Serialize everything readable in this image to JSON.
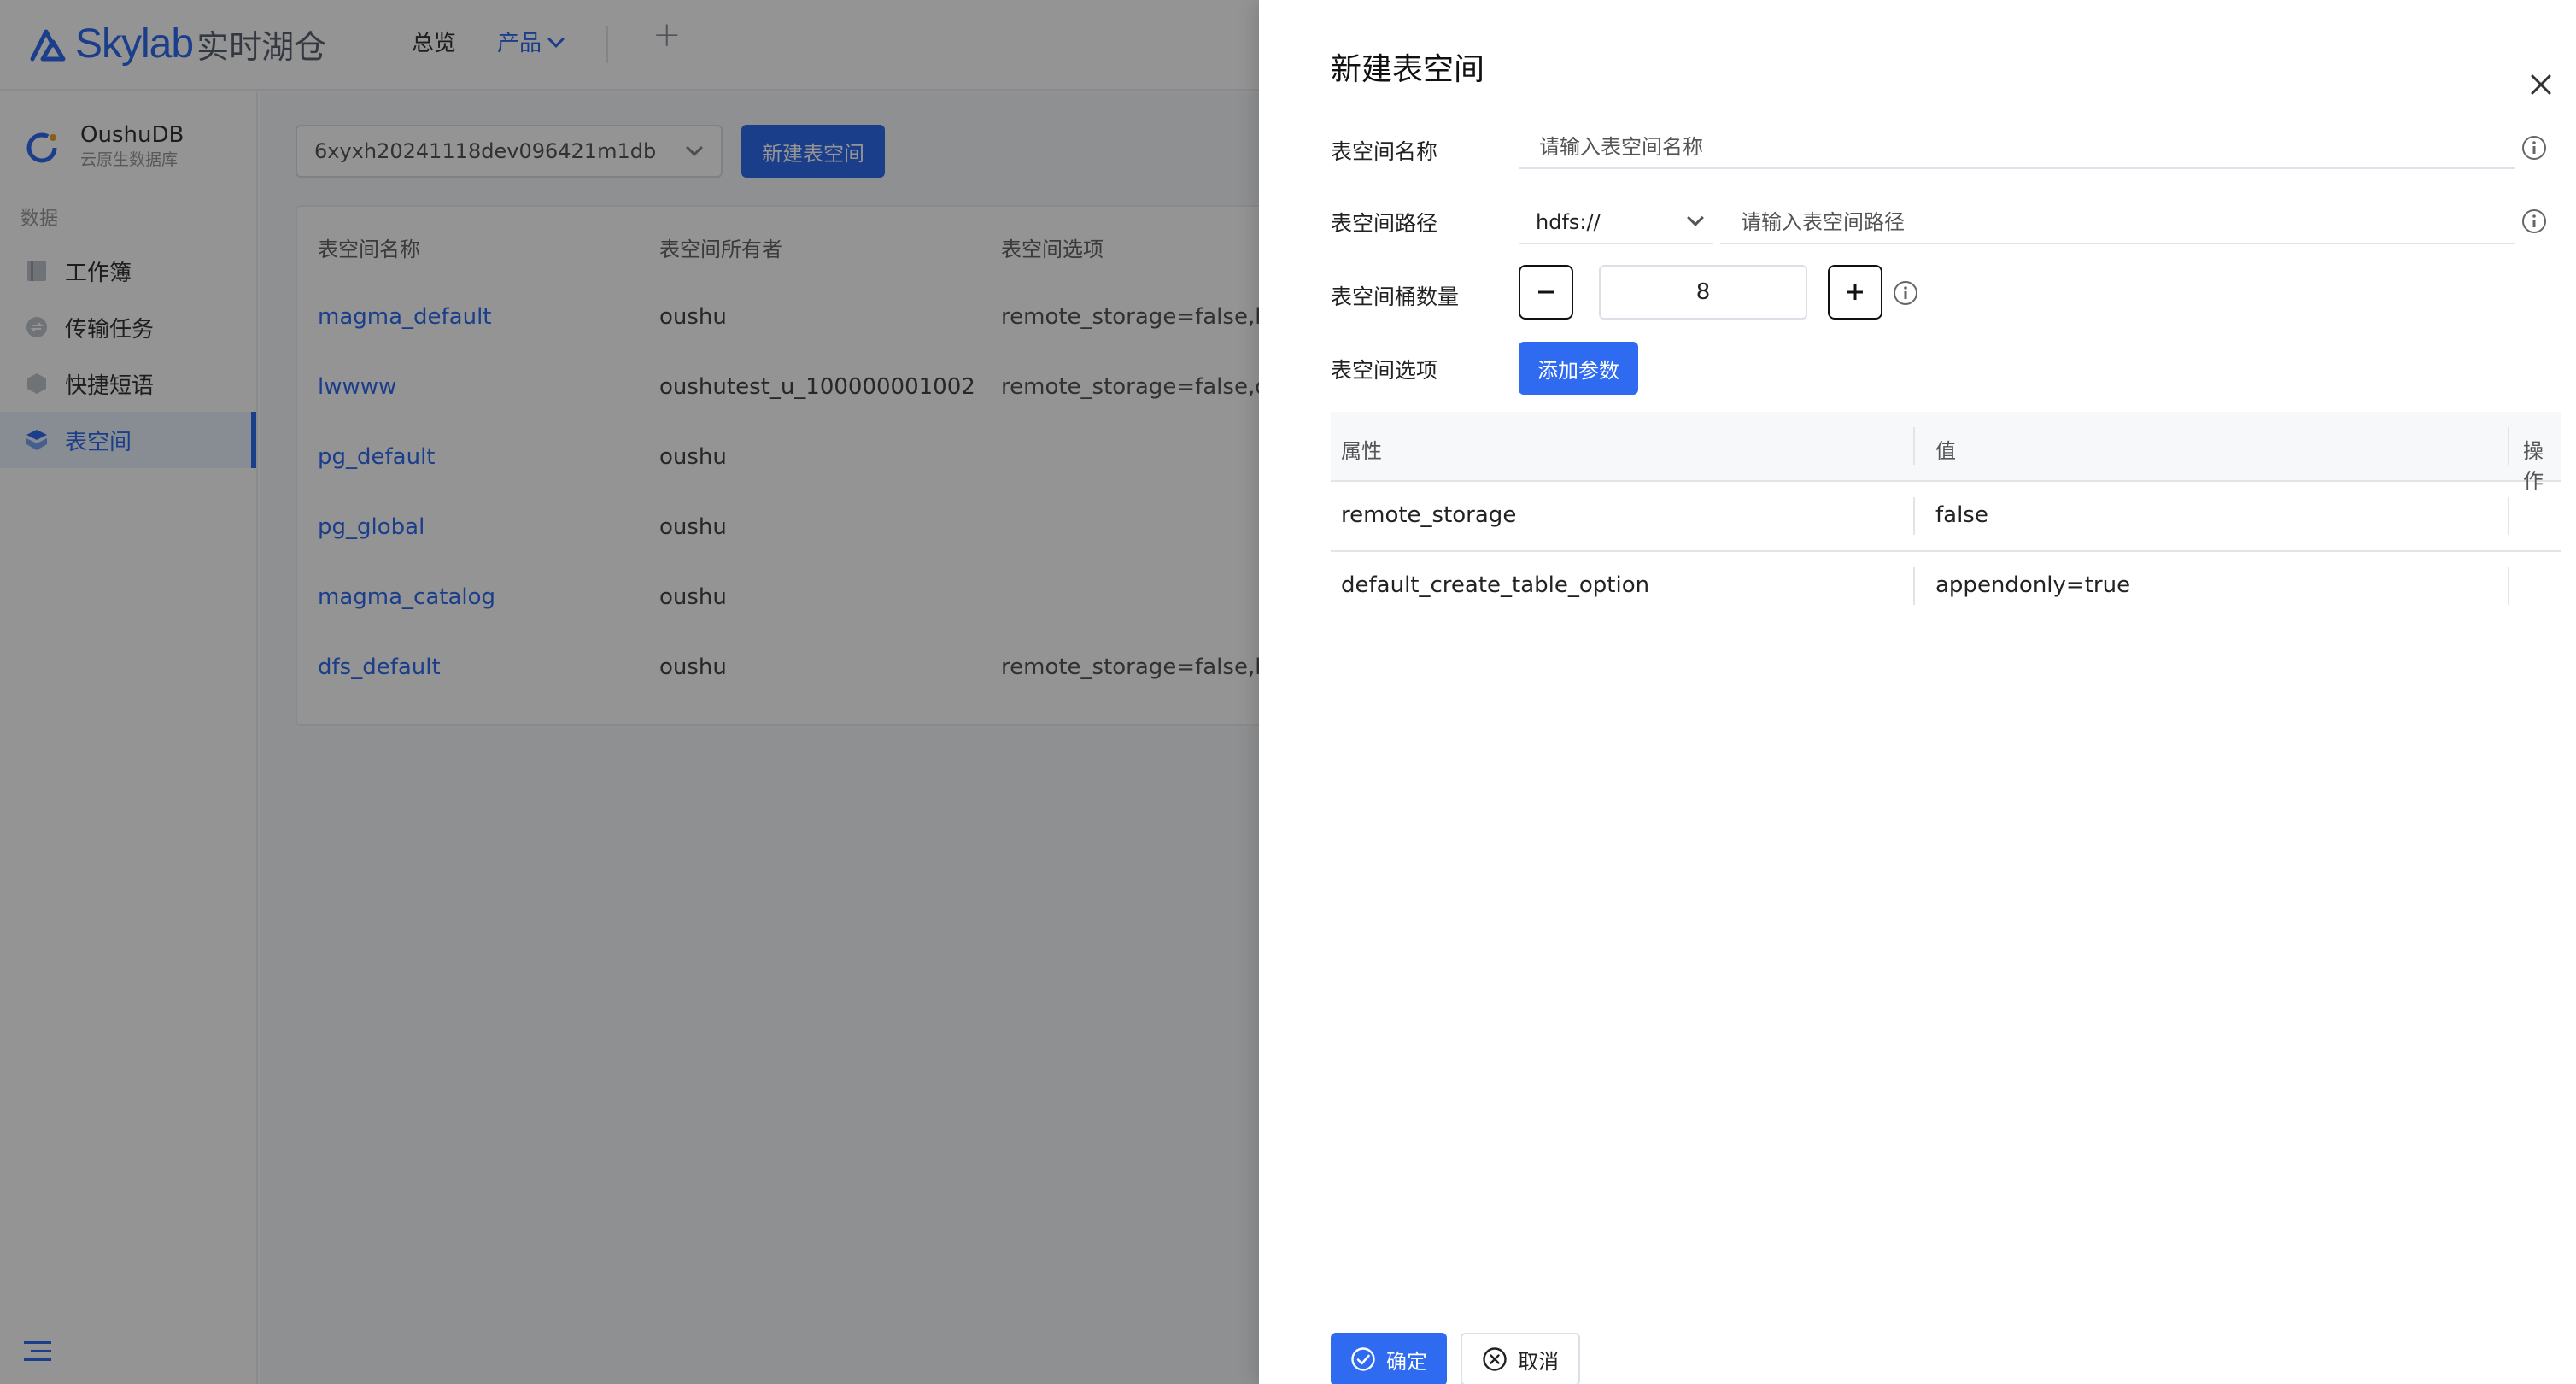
{
  "header": {
    "brand": "Skylab",
    "brand_sub": "实时湖仓",
    "nav": [
      {
        "label": "总览"
      },
      {
        "label": "产品"
      }
    ]
  },
  "sidebar": {
    "product_name": "OushuDB",
    "product_desc": "云原生数据库",
    "section": "数据",
    "items": [
      {
        "label": "工作簿"
      },
      {
        "label": "传输任务"
      },
      {
        "label": "快捷短语"
      },
      {
        "label": "表空间"
      }
    ]
  },
  "main": {
    "db_select_value": "6xyxh20241118dev096421m1db",
    "create_button": "新建表空间",
    "table": {
      "columns": [
        "表空间名称",
        "表空间所有者",
        "表空间选项"
      ],
      "rows": [
        {
          "name": "magma_default",
          "owner": "oushu",
          "options": "remote_storage=false,b"
        },
        {
          "name": "lwwww",
          "owner": "oushutest_u_100000001002",
          "options": "remote_storage=false,d"
        },
        {
          "name": "pg_default",
          "owner": "oushu",
          "options": ""
        },
        {
          "name": "pg_global",
          "owner": "oushu",
          "options": ""
        },
        {
          "name": "magma_catalog",
          "owner": "oushu",
          "options": ""
        },
        {
          "name": "dfs_default",
          "owner": "oushu",
          "options": "remote_storage=false,b"
        }
      ]
    }
  },
  "drawer": {
    "title": "新建表空间",
    "fields": {
      "name_label": "表空间名称",
      "name_placeholder": "请输入表空间名称",
      "path_label": "表空间路径",
      "path_scheme": "hdfs://",
      "path_placeholder": "请输入表空间路径",
      "bucket_label": "表空间桶数量",
      "bucket_value": "8",
      "options_label": "表空间选项",
      "add_param": "添加参数"
    },
    "param_table": {
      "columns": [
        "属性",
        "值",
        "操作"
      ],
      "rows": [
        {
          "key": "remote_storage",
          "value": "false"
        },
        {
          "key": "default_create_table_option",
          "value": "appendonly=true"
        }
      ]
    },
    "ok_label": "确定",
    "cancel_label": "取消"
  },
  "colors": {
    "accent": "#2f6bf0",
    "mask": "rgba(0,0,0,0.42)"
  }
}
